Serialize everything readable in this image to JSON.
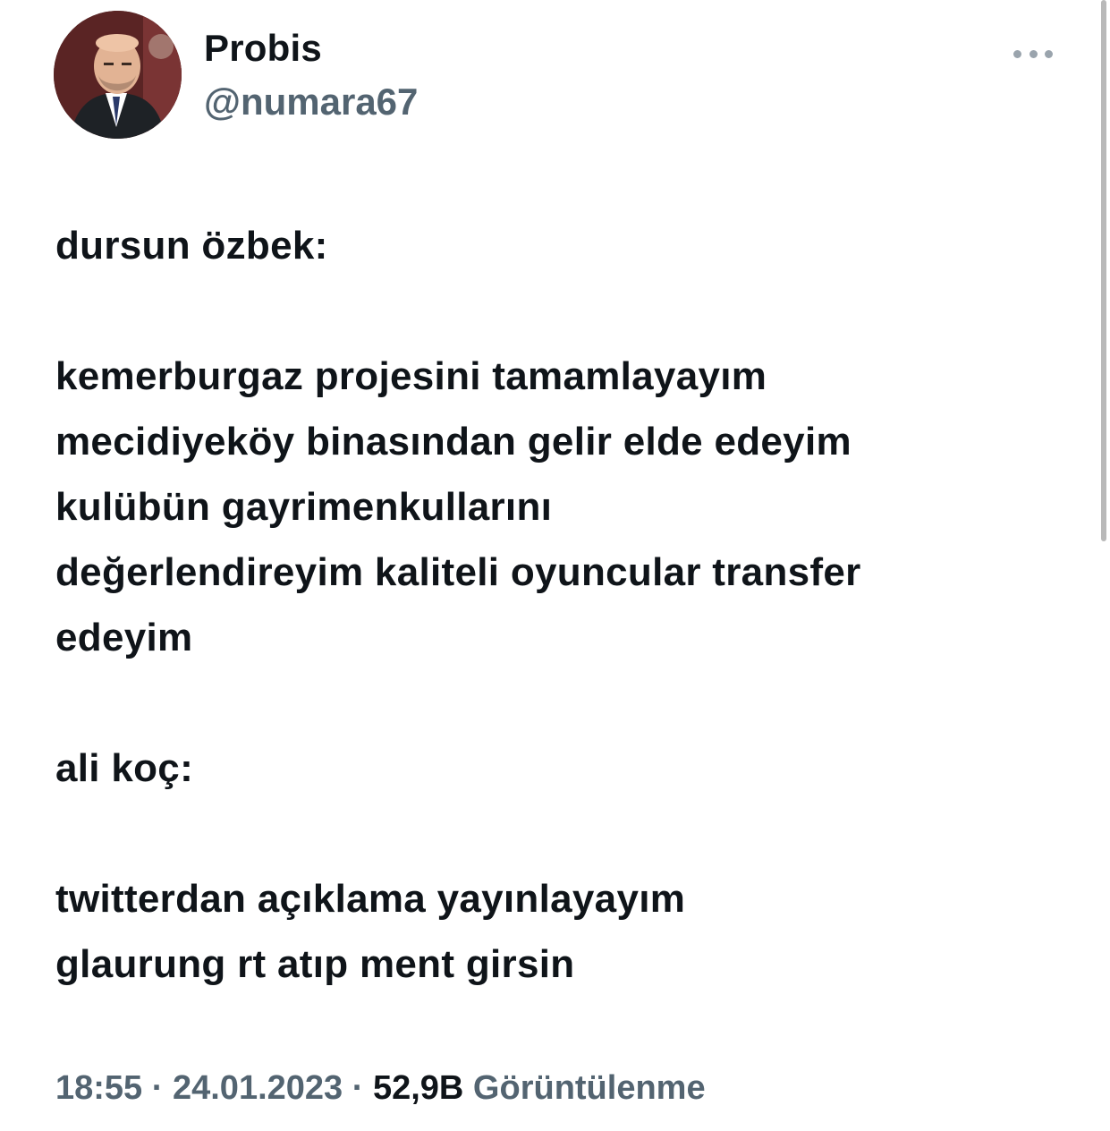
{
  "tweet": {
    "display_name": "Probis",
    "handle": "@numara67",
    "body": {
      "speaker1": "dursun özbek:",
      "lines1": [
        "kemerburgaz projesini tamamlayayım",
        "mecidiyeköy binasından gelir elde edeyim",
        "kulübün gayrimenkullarını",
        "değerlendireyim kaliteli oyuncular transfer",
        "edeyim"
      ],
      "speaker2": "ali koç:",
      "lines2": [
        "twitterdan açıklama yayınlayayım",
        "glaurung rt atıp ment girsin"
      ]
    },
    "meta": {
      "time": "18:55",
      "separator": " · ",
      "date": "24.01.2023",
      "views_count": "52,9B",
      "views_label": "Görüntülenme"
    },
    "icons": {
      "more": "more-horizontal-icon",
      "avatar": "avatar-photo"
    },
    "colors": {
      "text": "#0f1419",
      "secondary": "#536471",
      "background": "#ffffff"
    }
  }
}
